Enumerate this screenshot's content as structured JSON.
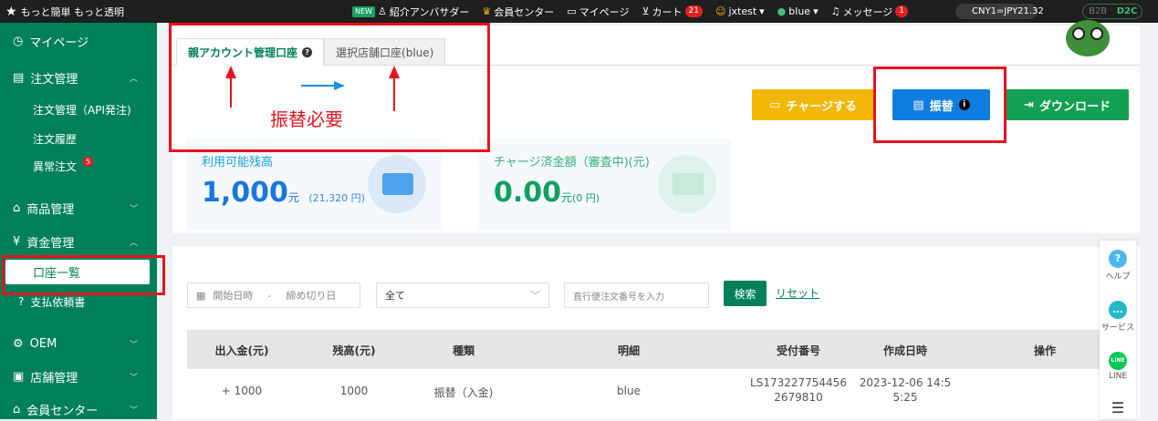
{
  "topbar": {
    "logo_text": "もっと簡単 もっと透明",
    "new_tag": "NEW",
    "ambassador": "紹介アンバサダー",
    "member_center": "会員センター",
    "mypage": "マイページ",
    "cart": "カート",
    "cart_count": "21",
    "user": "jxtest",
    "shop": "blue",
    "messages": "メッセージ",
    "message_count": "1",
    "rate": "CNY1=JPY21.32",
    "b2b": "B2B",
    "d2c": "D2C"
  },
  "sidebar": {
    "mypage": "マイページ",
    "order_mgmt": "注文管理",
    "order_api": "注文管理（API発注)",
    "order_history": "注文履歴",
    "abnormal": "異常注文",
    "abnormal_count": "5",
    "product_mgmt": "商品管理",
    "funds_mgmt": "資金管理",
    "account_list": "口座一覧",
    "payment_request": "支払依頼書",
    "oem": "OEM",
    "store_mgmt": "店舗管理",
    "member_center": "会員センター"
  },
  "tabs": {
    "parent": "親アカウント管理口座",
    "selected_store": "選択店舗口座(blue)"
  },
  "annotation": {
    "text": "振替必要"
  },
  "buttons": {
    "charge": "チャージする",
    "transfer": "振替",
    "download": "ダウンロード"
  },
  "stats": {
    "available_label": "利用可能残高",
    "available_value": "1,000",
    "available_unit": "元",
    "available_jpy": "(21,320 円)",
    "charged_label": "チャージ済金額（審査中)(元)",
    "charged_value": "0.00",
    "charged_unit": "元",
    "charged_jpy": "(0 円)"
  },
  "filters": {
    "start_date": "開始日時",
    "dash": "-",
    "end_date": "締め切り日",
    "type_selected": "全て",
    "order_placeholder": "直行便注文番号を入力",
    "search": "検索",
    "reset": "リセット"
  },
  "table": {
    "headers": [
      "出入金(元)",
      "残高(元)",
      "種類",
      "明細",
      "受付番号",
      "作成日時",
      "操作"
    ],
    "rows": [
      {
        "amount": "+ 1000",
        "balance": "1000",
        "type": "振替（入金)",
        "detail": "blue",
        "receipt_line1": "LS173227754456",
        "receipt_line2": "2679810",
        "created_line1": "2023-12-06 14:5",
        "created_line2": "5:25"
      }
    ]
  },
  "rightbar": {
    "help": "ヘルプ",
    "service": "サービス",
    "line": "LINE",
    "line_icon_text": "LINE"
  }
}
